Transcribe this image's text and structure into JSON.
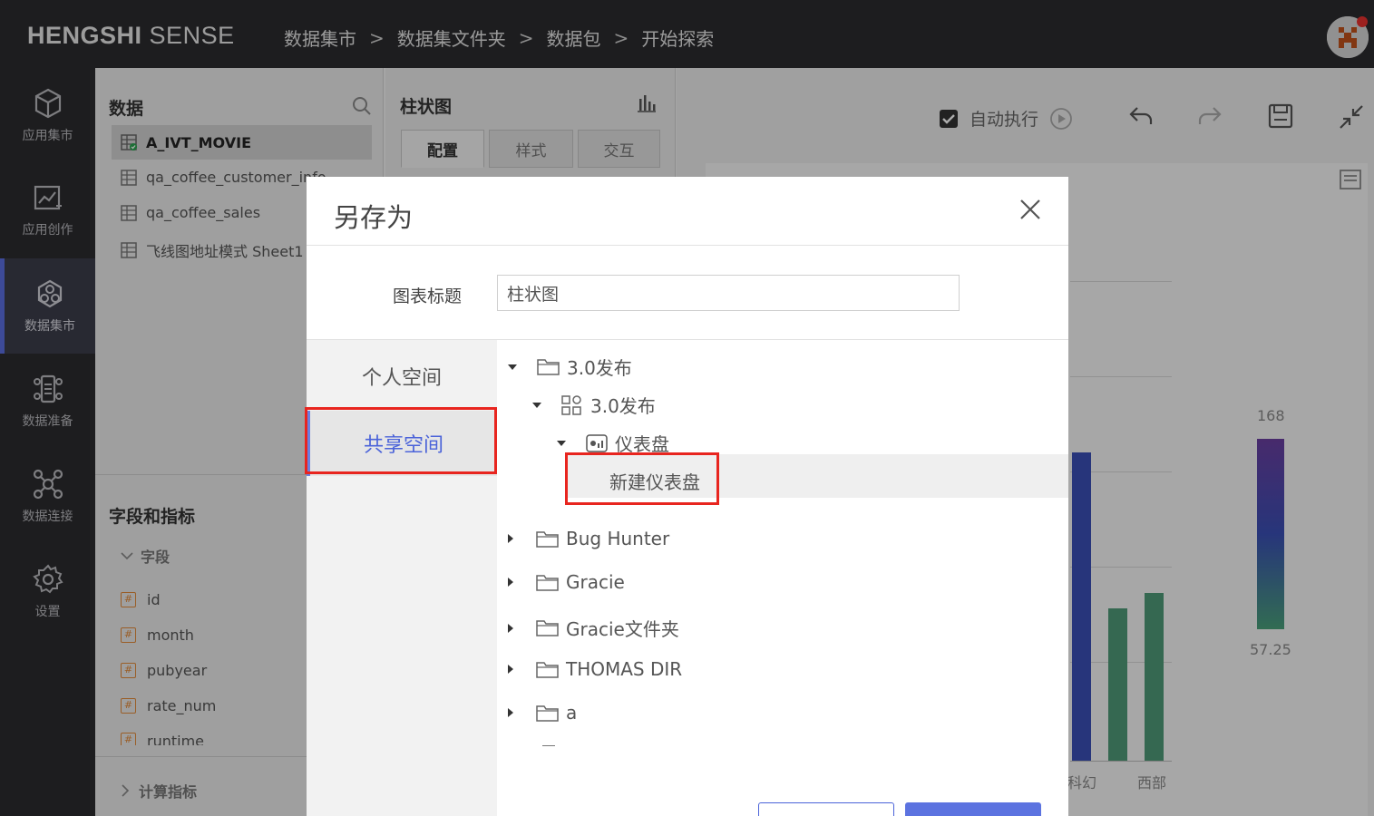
{
  "brand": {
    "bold": "HENGSHI",
    "light": "SENSE"
  },
  "breadcrumbs": [
    "数据集市",
    "数据集文件夹",
    "数据包",
    "开始探索"
  ],
  "breadcrumb_sep": ">",
  "leftnav": [
    {
      "label": "应用集市",
      "icon": "cube-icon"
    },
    {
      "label": "应用创作",
      "icon": "chart-edit-icon"
    },
    {
      "label": "数据集市",
      "icon": "dataset-market-icon",
      "active": true
    },
    {
      "label": "数据准备",
      "icon": "data-prep-icon"
    },
    {
      "label": "数据连接",
      "icon": "network-icon"
    },
    {
      "label": "设置",
      "icon": "gear-icon"
    }
  ],
  "data_panel": {
    "title": "数据",
    "datasets": [
      "A_IVT_MOVIE",
      "qa_coffee_customer_info",
      "qa_coffee_sales",
      "飞线图地址模式 Sheet1"
    ],
    "fields_title": "字段和指标",
    "fields_group": "字段",
    "fields": [
      "id",
      "month",
      "pubyear",
      "rate_num",
      "runtime"
    ],
    "metrics_group": "计算指标"
  },
  "config_panel": {
    "title": "柱状图",
    "tabs": [
      "配置",
      "样式",
      "交互"
    ]
  },
  "toolbar": {
    "auto_run": "自动执行"
  },
  "chart": {
    "bar_labels": [
      "科幻",
      "西部"
    ],
    "legend_max": "168",
    "legend_min": "57.25",
    "colors": {
      "blue": "#3a4fb5",
      "green": "#4f9a78",
      "gradient_top": "#6a3fa0",
      "gradient_bottom": "#4aa07a"
    }
  },
  "modal": {
    "title": "另存为",
    "label_chart_title": "图表标题",
    "input_value": "柱状图",
    "spaces": [
      "个人空间",
      "共享空间"
    ],
    "tree": [
      {
        "label": "3.0发布",
        "level": 0,
        "expanded": true,
        "icon": "folder-icon"
      },
      {
        "label": "3.0发布",
        "level": 1,
        "expanded": true,
        "icon": "app-icon"
      },
      {
        "label": "仪表盘",
        "level": 2,
        "expanded": true,
        "icon": "dashboard-icon"
      },
      {
        "label": "新建仪表盘",
        "level": 3
      },
      {
        "label": "Bug Hunter",
        "level": 0,
        "icon": "folder-icon"
      },
      {
        "label": "Gracie",
        "level": 0,
        "icon": "folder-icon"
      },
      {
        "label": "Gracie文件夹",
        "level": 0,
        "icon": "folder-icon"
      },
      {
        "label": "THOMAS DIR",
        "level": 0,
        "icon": "folder-icon"
      },
      {
        "label": "a",
        "level": 0,
        "icon": "folder-icon"
      }
    ]
  }
}
